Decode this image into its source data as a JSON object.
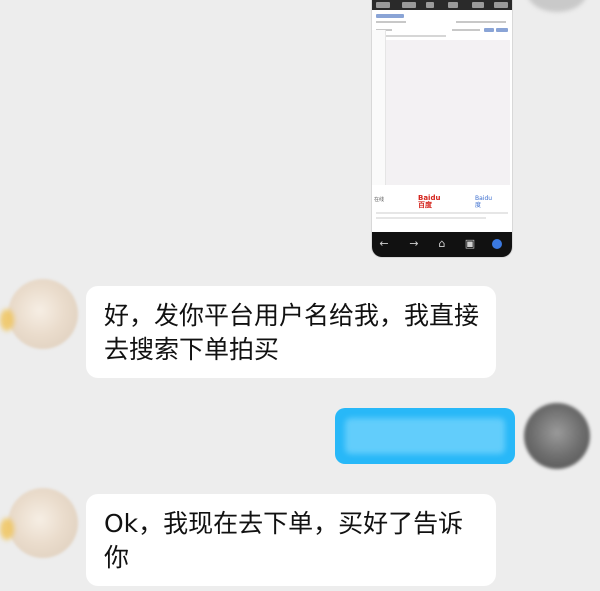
{
  "messages": [
    {
      "sender": "contact",
      "text": "好，发你平台用户名给我，我直接去搜索下单拍买"
    },
    {
      "sender": "me",
      "text": ""
    },
    {
      "sender": "contact",
      "text": "Ok，我现在去下单，买好了告诉你"
    }
  ],
  "screenshot": {
    "footer_left": "在线",
    "logo_left": "Baidu百度",
    "logo_right": "Baidu度"
  },
  "colors": {
    "background": "#ededed",
    "bubble_contact": "#ffffff",
    "bubble_me": "#28b8f8"
  },
  "icons": [
    "back-icon",
    "forward-icon",
    "home-icon",
    "tabs-icon",
    "menu-icon"
  ]
}
